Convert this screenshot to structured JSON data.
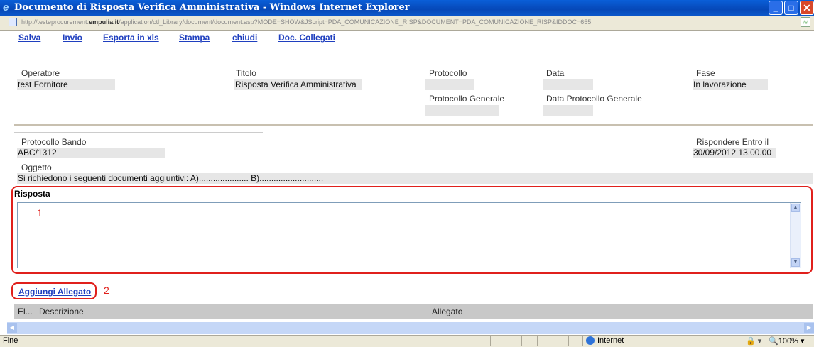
{
  "window": {
    "title": "Documento di Risposta Verifica Amministrativa - Windows Internet Explorer",
    "min_glyph": "_",
    "max_glyph": "□",
    "close_glyph": "✕"
  },
  "address": {
    "url_prefix": "http://testeprocurement.",
    "url_domain": "empulia.it",
    "url_rest": "/application/ctl_Library/document/document.asp?MODE=SHOW&JScript=PDA_COMUNICAZIONE_RISP&DOCUMENT=PDA_COMUNICAZIONE_RISP&IDDOC=655"
  },
  "toolbar": {
    "save_label": "Salva",
    "send_label": "Invio",
    "export_label": "Esporta in xls",
    "print_label": "Stampa",
    "close_label": "chiudi",
    "linked_docs_label": "Doc. Collegati"
  },
  "header": {
    "operatore_label": "Operatore",
    "operatore_value": "test Fornitore",
    "titolo_label": "Titolo",
    "titolo_value": "Risposta Verifica Amministrativa",
    "protocollo_label": "Protocollo",
    "protocollo_value": "",
    "data_label": "Data",
    "data_value": "",
    "fase_label": "Fase",
    "fase_value": "In lavorazione",
    "protocollo_generale_label": "Protocollo Generale",
    "protocollo_generale_value": "",
    "data_protocollo_generale_label": "Data Protocollo Generale",
    "data_protocollo_generale_value": ""
  },
  "details": {
    "protocollo_bando_label": "Protocollo Bando",
    "protocollo_bando_value": "ABC/1312",
    "rispondere_entro_label": "Rispondere Entro il",
    "rispondere_entro_value": "30/09/2012 13.00.00",
    "oggetto_label": "Oggetto",
    "oggetto_value": "Si richiedono i seguenti documenti aggiuntivi: A)..................... B)..........................."
  },
  "risposta": {
    "label": "Risposta",
    "value": "",
    "annotation": "1"
  },
  "attachments": {
    "add_label": "Aggiungi Allegato",
    "annotation": "2",
    "col_el": "El...",
    "col_descrizione": "Descrizione",
    "col_allegato": "Allegato"
  },
  "status": {
    "text": "Fine",
    "zone": "Internet",
    "zoom": "100%",
    "zoom_icon": "🔍",
    "protected_glyph": "🔒 ▾"
  },
  "icons": {
    "ie": "e",
    "scroll_up": "▲",
    "scroll_down": "▼",
    "scroll_left": "◀",
    "scroll_right": "▶",
    "rss": "≋"
  }
}
